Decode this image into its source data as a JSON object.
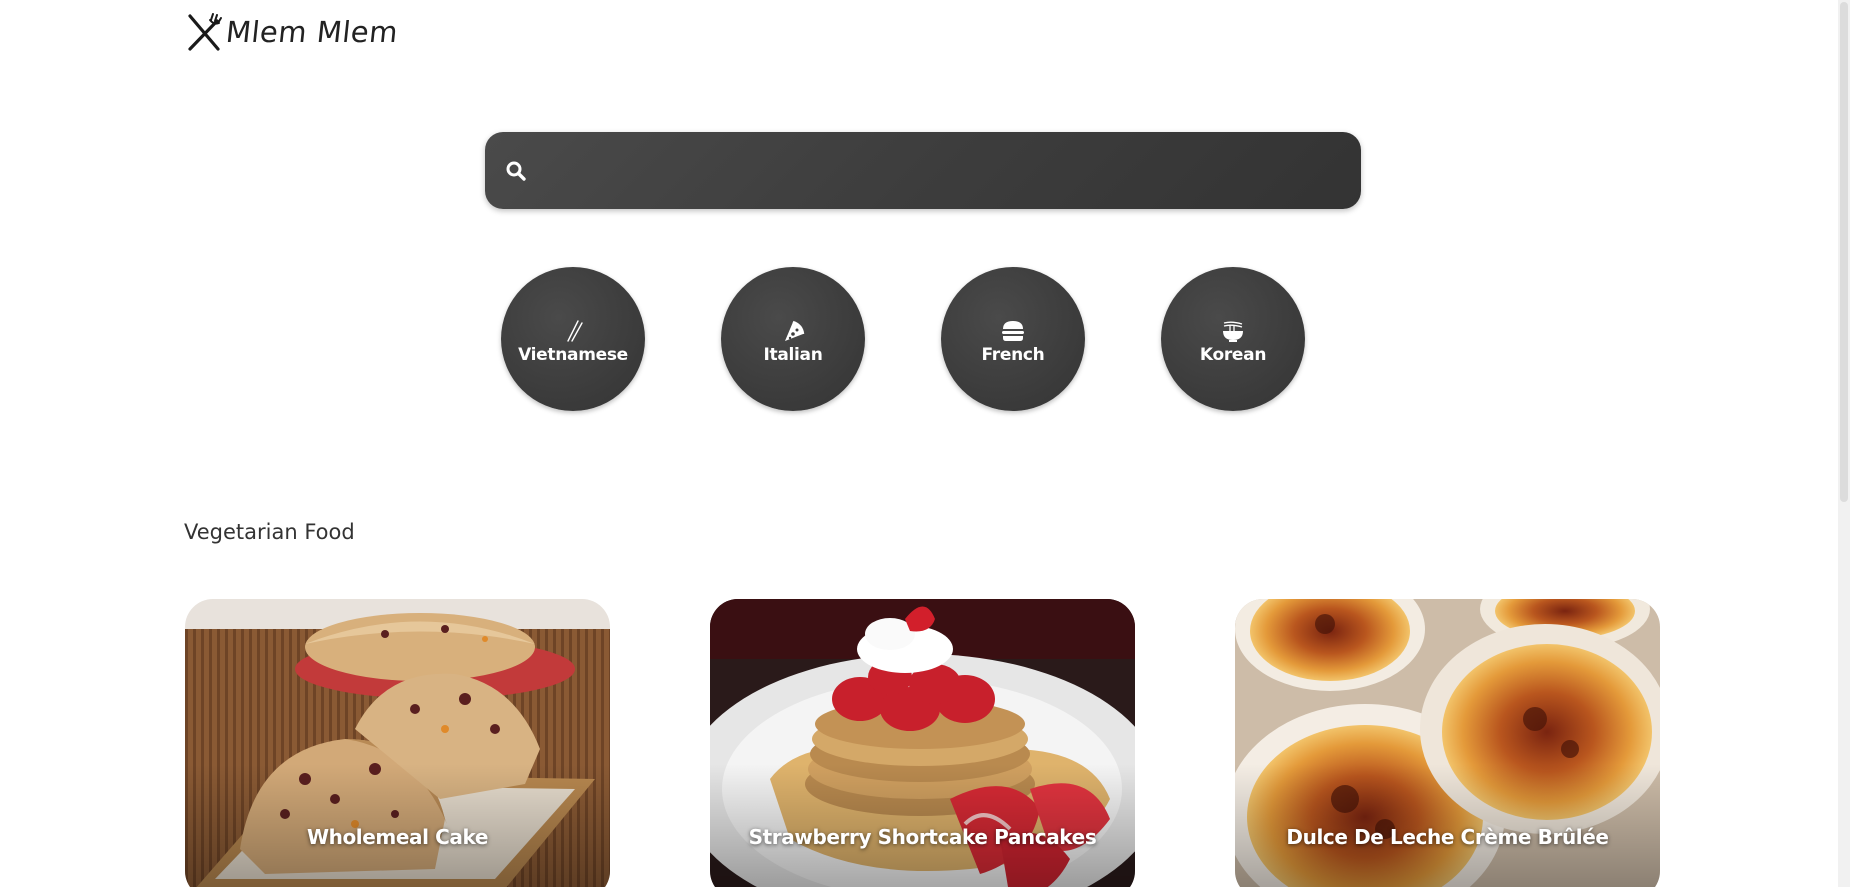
{
  "header": {
    "logo_text": "Mlem Mlem",
    "logo_icon": "fork-knife-icon"
  },
  "search": {
    "value": "",
    "placeholder": "",
    "icon": "search-icon"
  },
  "cuisines": [
    {
      "label": "Vietnamese",
      "icon": "chopsticks-icon"
    },
    {
      "label": "Italian",
      "icon": "pizza-icon"
    },
    {
      "label": "French",
      "icon": "burger-icon"
    },
    {
      "label": "Korean",
      "icon": "noodle-bowl-icon"
    }
  ],
  "section": {
    "title": "Vegetarian Food",
    "cards": [
      {
        "title": "Wholemeal Cake"
      },
      {
        "title": "Strawberry Shortcake Pancakes"
      },
      {
        "title": "Dulce De Leche Crème Brûlée"
      }
    ]
  },
  "colors": {
    "dark_surface": "#3d3d3d",
    "text_primary": "#333333",
    "on_dark": "#ffffff"
  }
}
